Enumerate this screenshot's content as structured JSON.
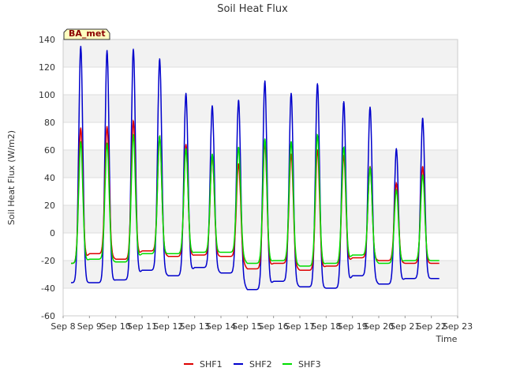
{
  "chart_data": {
    "type": "line",
    "title": "Soil Heat Flux",
    "xlabel": "Time",
    "ylabel": "Soil Heat Flux (W/m2)",
    "site_label": "BA_met",
    "x_ticks": [
      "Sep 8",
      "Sep 9",
      "Sep 10",
      "Sep 11",
      "Sep 12",
      "Sep 13",
      "Sep 14",
      "Sep 15",
      "Sep 16",
      "Sep 17",
      "Sep 18",
      "Sep 19",
      "Sep 20",
      "Sep 21",
      "Sep 22",
      "Sep 23"
    ],
    "y_ticks": [
      -60,
      -40,
      -20,
      0,
      20,
      40,
      60,
      80,
      100,
      120,
      140
    ],
    "xlim_days": [
      8,
      23
    ],
    "ylim": [
      -60,
      140
    ],
    "grid": true,
    "legend_position": "bottom-center",
    "days": [
      "Sep 8",
      "Sep 9",
      "Sep 10",
      "Sep 11",
      "Sep 12",
      "Sep 13",
      "Sep 14",
      "Sep 15",
      "Sep 16",
      "Sep 17",
      "Sep 18",
      "Sep 19",
      "Sep 20",
      "Sep 21",
      "Sep 22"
    ],
    "series": [
      {
        "name": "SHF1",
        "color": "#dd0000",
        "daily_peak": [
          76,
          77,
          81,
          70,
          64,
          56,
          50,
          65,
          57,
          60,
          56,
          48,
          36,
          48
        ],
        "daily_trough": [
          -22,
          -15,
          -19,
          -13,
          -17,
          -16,
          -17,
          -26,
          -22,
          -27,
          -24,
          -18,
          -20,
          -22
        ]
      },
      {
        "name": "SHF2",
        "color": "#0000cc",
        "daily_peak": [
          135,
          132,
          133,
          126,
          101,
          92,
          96,
          110,
          101,
          108,
          95,
          91,
          61,
          83
        ],
        "daily_trough": [
          -36,
          -36,
          -34,
          -27,
          -31,
          -25,
          -29,
          -41,
          -35,
          -39,
          -40,
          -31,
          -37,
          -33
        ]
      },
      {
        "name": "SHF3",
        "color": "#00dd00",
        "daily_peak": [
          66,
          65,
          71,
          70,
          61,
          57,
          62,
          68,
          66,
          71,
          62,
          47,
          31,
          42
        ],
        "daily_trough": [
          -22,
          -19,
          -21,
          -15,
          -15,
          -14,
          -14,
          -22,
          -20,
          -24,
          -22,
          -16,
          -22,
          -20
        ]
      }
    ]
  }
}
